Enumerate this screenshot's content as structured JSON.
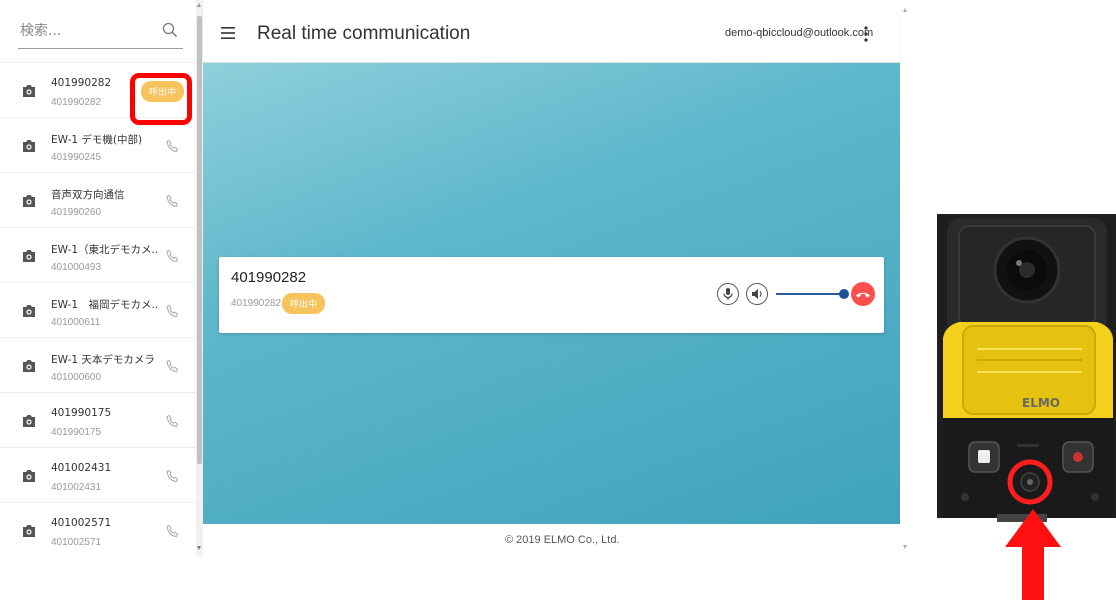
{
  "search": {
    "placeholder": "検索..."
  },
  "devices": [
    {
      "name": "401990282",
      "number": "401990282",
      "status": "呼出中"
    },
    {
      "name": "EW-1 デモ機(中部)",
      "number": "401990245"
    },
    {
      "name": "音声双方向通信",
      "number": "401990260"
    },
    {
      "name": "EW-1（東北デモカメ..",
      "number": "401000493"
    },
    {
      "name": "EW-1　福岡デモカメ..",
      "number": "401000611"
    },
    {
      "name": "EW-1 天本デモカメラ",
      "number": "401000600"
    },
    {
      "name": "401990175",
      "number": "401990175"
    },
    {
      "name": "401002431",
      "number": "401002431"
    },
    {
      "name": "401002571",
      "number": "401002571"
    }
  ],
  "header": {
    "title": "Real time communication",
    "account": "demo-qbiccloud@outlook.com"
  },
  "call": {
    "title": "401990282",
    "number": "401990282",
    "status": "呼出中",
    "volume_fraction": 0.93
  },
  "footer": {
    "copyright": "© 2019 ELMO Co., Ltd."
  },
  "camera": {
    "brand": "ELMO"
  },
  "colors": {
    "badge": "#f7c35c",
    "highlight": "#ff0000",
    "hangup": "#ff4e4e",
    "stage": "#4faec5"
  },
  "icons": {
    "search": "search-icon",
    "camera": "camera-icon",
    "phone": "phone-icon",
    "menu": "hamburger-menu-icon",
    "more": "kebab-menu-icon",
    "mic": "microphone-icon",
    "speaker": "speaker-icon",
    "hangup": "hang-up-icon"
  }
}
